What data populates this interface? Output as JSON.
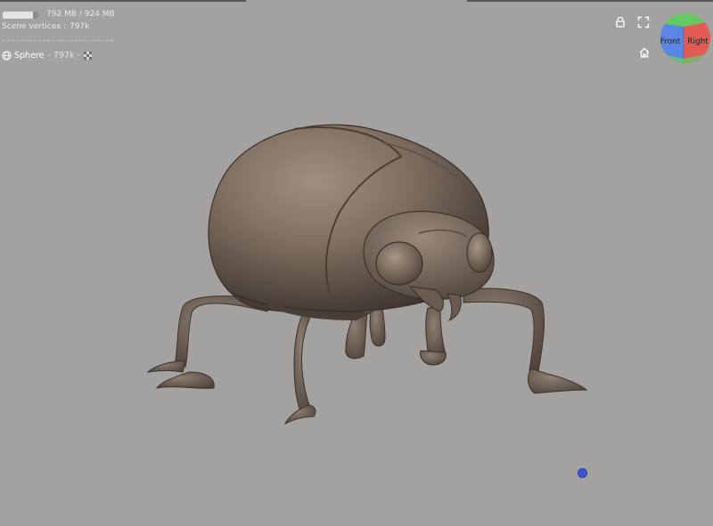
{
  "hud": {
    "memory_text": "792 MB / 924 MB",
    "memory_used_fraction": 0.857,
    "vertices_label": "Scene vertices :",
    "vertices_value": "797k"
  },
  "mesh": {
    "name": "Sphere",
    "vertex_count": " - 797k",
    "separator": "-"
  },
  "view_cube": {
    "front_label": "Front",
    "right_label": "Right"
  },
  "icons": {
    "lock": "lock-icon",
    "fullscreen": "fullscreen-icon",
    "home": "home-icon",
    "sphere": "sphere-icon",
    "checker": "checker-icon"
  },
  "colors": {
    "background": "#a4a2a0",
    "model": "#7d6e62",
    "view_cube_front": "#5b86e6",
    "view_cube_right": "#e45a55",
    "view_cube_top": "#63c963",
    "pivot": "#3c55d6"
  }
}
